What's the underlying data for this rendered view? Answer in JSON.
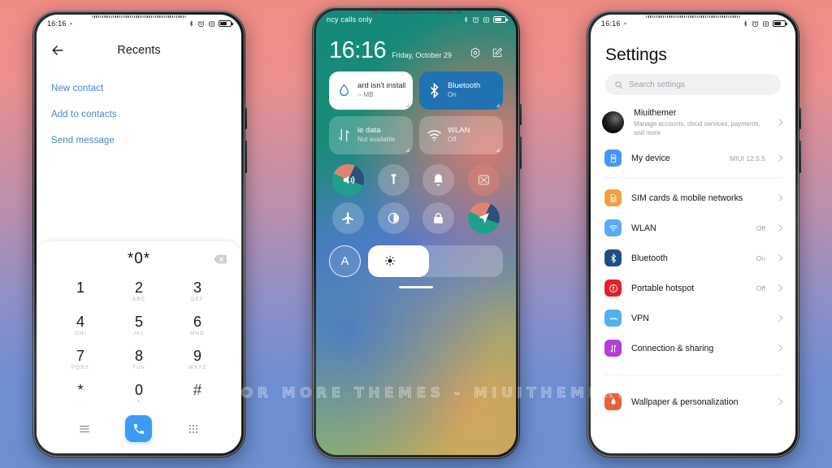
{
  "watermark": "VISIT FOR MORE THEMES - MIUITHEMER.COM",
  "background": {
    "top_color": "#ef8c84",
    "bottom_color": "#6b8ecf"
  },
  "phone_left": {
    "status_bar": {
      "time": "16:16",
      "icons": [
        "bluetooth-icon",
        "alarm-icon",
        "vibrate-icon",
        "battery-icon"
      ]
    },
    "header": {
      "title": "Recents",
      "back": "back-arrow-icon"
    },
    "contact_actions": [
      {
        "label": "New contact"
      },
      {
        "label": "Add to contacts"
      },
      {
        "label": "Send message"
      }
    ],
    "dialer": {
      "number": "*0*",
      "keys": [
        {
          "digit": "1",
          "letters": ""
        },
        {
          "digit": "2",
          "letters": "ABC"
        },
        {
          "digit": "3",
          "letters": "DEF"
        },
        {
          "digit": "4",
          "letters": "GHI"
        },
        {
          "digit": "5",
          "letters": "JKL"
        },
        {
          "digit": "6",
          "letters": "MNO"
        },
        {
          "digit": "7",
          "letters": "PQRS"
        },
        {
          "digit": "8",
          "letters": "TUV"
        },
        {
          "digit": "9",
          "letters": "WXYZ"
        },
        {
          "digit": "*",
          "letters": ","
        },
        {
          "digit": "0",
          "letters": "+"
        },
        {
          "digit": "#",
          "letters": ""
        }
      ],
      "accent_color": "#3d9bf5"
    }
  },
  "phone_middle": {
    "status_bar": {
      "carrier": "ncy calls only",
      "icons": [
        "bluetooth-icon",
        "alarm-icon",
        "vibrate-icon",
        "battery-icon"
      ]
    },
    "clock": {
      "time": "16:16",
      "date": "Friday, October 29"
    },
    "header_icons": [
      "settings-gear-icon",
      "edit-icon"
    ],
    "tiles": [
      {
        "title": "ard isn't install",
        "sub": "-- MB",
        "state": "on-white",
        "icon": "water-drop-icon"
      },
      {
        "title": "Bluetooth",
        "sub": "On",
        "state": "on-blue",
        "icon": "bluetooth-icon"
      },
      {
        "title": "le data",
        "sub": "Not available",
        "state": "dim",
        "icon": "mobile-data-icon"
      },
      {
        "title": "WLAN",
        "sub": "Off",
        "state": "dim",
        "icon": "wifi-icon"
      }
    ],
    "toggles": [
      {
        "name": "sound-icon",
        "style": "themed"
      },
      {
        "name": "flashlight-icon",
        "style": "plain"
      },
      {
        "name": "bell-icon",
        "style": "plain"
      },
      {
        "name": "screenshot-icon",
        "style": "rose"
      },
      {
        "name": "airplane-icon",
        "style": "plain"
      },
      {
        "name": "dark-mode-icon",
        "style": "plain"
      },
      {
        "name": "lock-icon",
        "style": "plain"
      },
      {
        "name": "location-icon",
        "style": "themed"
      }
    ],
    "brightness": {
      "auto_label": "A",
      "level_percent": 45,
      "icon": "sun-icon"
    }
  },
  "phone_right": {
    "status_bar": {
      "time": "16:16",
      "icons": [
        "bluetooth-icon",
        "alarm-icon",
        "vibrate-icon",
        "battery-icon"
      ]
    },
    "title": "Settings",
    "search": {
      "placeholder": "Search settings",
      "icon": "search-icon"
    },
    "account": {
      "name": "Miuithemer",
      "desc": "Manage accounts, cloud services, payments, and more"
    },
    "device": {
      "label": "My device",
      "value": "MIUI 12.5.5",
      "icon_color": "#4596f7"
    },
    "items": [
      {
        "label": "SIM cards & mobile networks",
        "value": "",
        "color": "#f0a13c",
        "icon": "sim-card-icon"
      },
      {
        "label": "WLAN",
        "value": "Off",
        "color": "#58aaf4",
        "icon": "wifi-icon"
      },
      {
        "label": "Bluetooth",
        "value": "On",
        "color": "#1d4e84",
        "icon": "bluetooth-icon"
      },
      {
        "label": "Portable hotspot",
        "value": "Off",
        "color": "#e32029",
        "icon": "hotspot-icon"
      },
      {
        "label": "VPN",
        "value": "",
        "color": "#53b0ef",
        "icon": "vpn-icon"
      },
      {
        "label": "Connection & sharing",
        "value": "",
        "color": "#b43fd6",
        "icon": "connection-sharing-icon"
      },
      {
        "label": "Wallpaper & personalization",
        "value": "",
        "color": "#e4633e",
        "icon": "wallpaper-icon"
      }
    ]
  }
}
